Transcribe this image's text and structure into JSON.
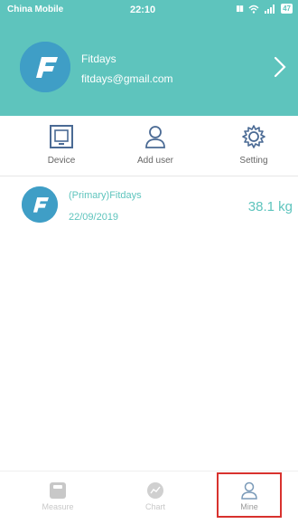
{
  "status_bar": {
    "carrier": "China Mobile",
    "time": "22:10",
    "battery": "47"
  },
  "profile": {
    "name": "Fitdays",
    "email": "fitdays@gmail.com"
  },
  "quick_actions": [
    {
      "label": "Device",
      "icon": "device-icon"
    },
    {
      "label": "Add user",
      "icon": "add-user-icon"
    },
    {
      "label": "Setting",
      "icon": "gear-icon"
    }
  ],
  "member": {
    "name": "(Primary)Fitdays",
    "date": "22/09/2019",
    "weight": "38.1 kg"
  },
  "tabs": [
    {
      "label": "Measure",
      "icon": "scale-icon"
    },
    {
      "label": "Chart",
      "icon": "chart-icon"
    },
    {
      "label": "Mine",
      "icon": "person-icon",
      "active": true
    }
  ],
  "colors": {
    "accent": "#5ec4bd",
    "avatar": "#3f9ec6",
    "highlight": "#d8322e"
  }
}
